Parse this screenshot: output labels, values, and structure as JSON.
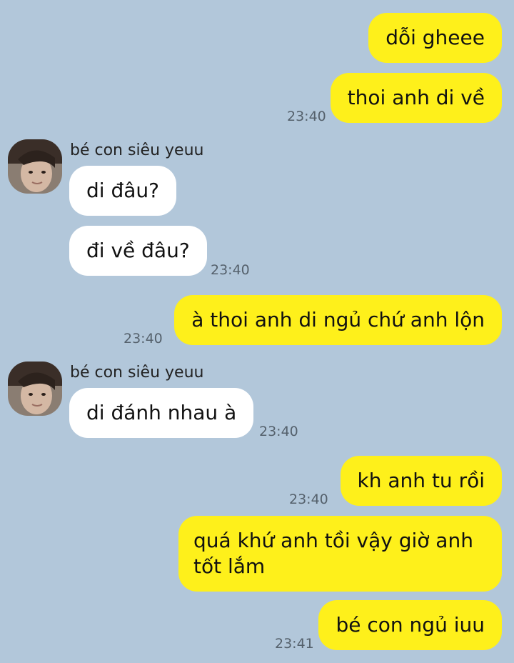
{
  "contact": {
    "name": "bé con siêu yeuu",
    "avatar_icon": "profile-photo-icon"
  },
  "colors": {
    "background": "#b2c7da",
    "outgoing_bubble": "#fef01b",
    "incoming_bubble": "#ffffff",
    "timestamp": "#55616c"
  },
  "messages": [
    {
      "from": "me",
      "text": "dỗi gheee"
    },
    {
      "from": "me",
      "text": "thoi anh di về",
      "time": "23:40"
    },
    {
      "from": "contact",
      "sender": "bé con siêu yeuu",
      "text": "di đâu?"
    },
    {
      "from": "contact",
      "text": "đi về đâu?",
      "time": "23:40"
    },
    {
      "from": "me",
      "text": "à thoi anh di ngủ chứ anh lộn",
      "time": "23:40"
    },
    {
      "from": "contact",
      "sender": "bé con siêu yeuu",
      "text": "di đánh nhau à",
      "time": "23:40"
    },
    {
      "from": "me",
      "text": "kh anh tu rồi",
      "time": "23:40"
    },
    {
      "from": "me",
      "text": "quá khứ anh tồi vậy giờ anh tốt lắm"
    },
    {
      "from": "me",
      "text": "bé con ngủ iuu",
      "time": "23:41"
    }
  ]
}
